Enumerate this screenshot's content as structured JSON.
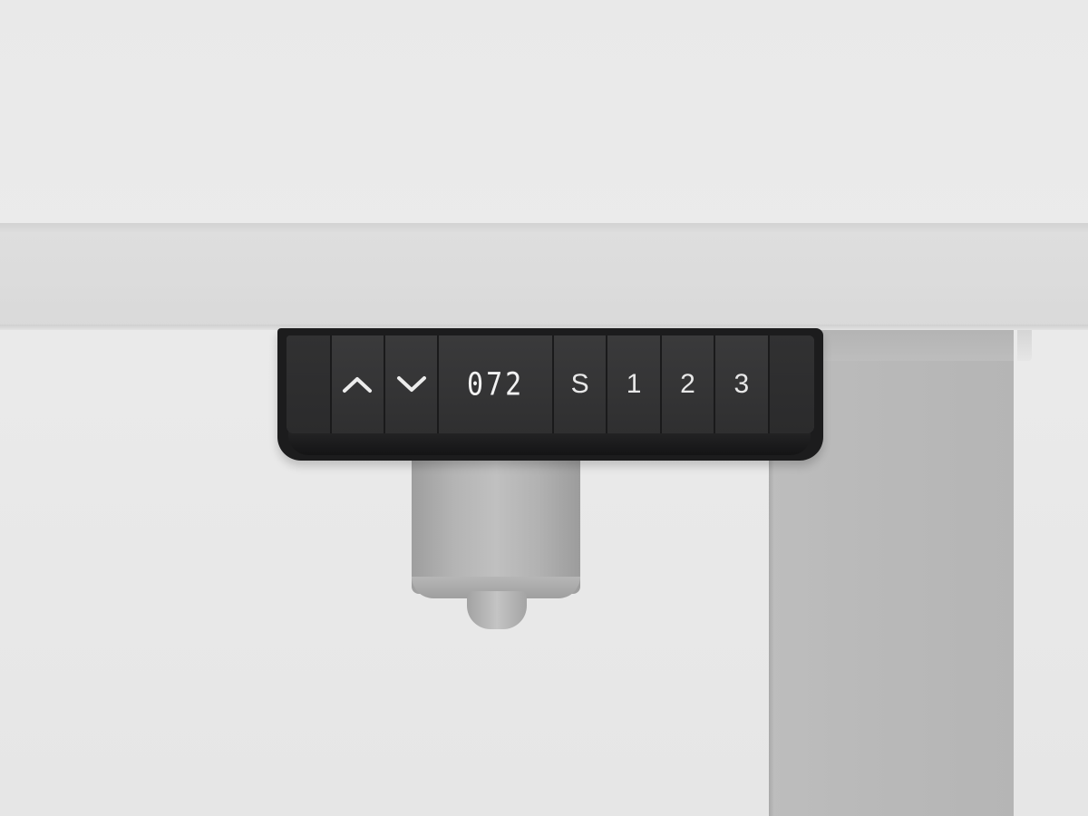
{
  "controller": {
    "display_value": "072",
    "buttons": {
      "up_icon": "chevron-up",
      "down_icon": "chevron-down",
      "save_label": "S",
      "preset_1_label": "1",
      "preset_2_label": "2",
      "preset_3_label": "3"
    }
  },
  "colors": {
    "background": "#e9e9e9",
    "desktop": "#dcdcdc",
    "leg": "#bababa",
    "panel": "#1c1c1d",
    "key": "#363637",
    "key_text": "#e8e8e8"
  }
}
